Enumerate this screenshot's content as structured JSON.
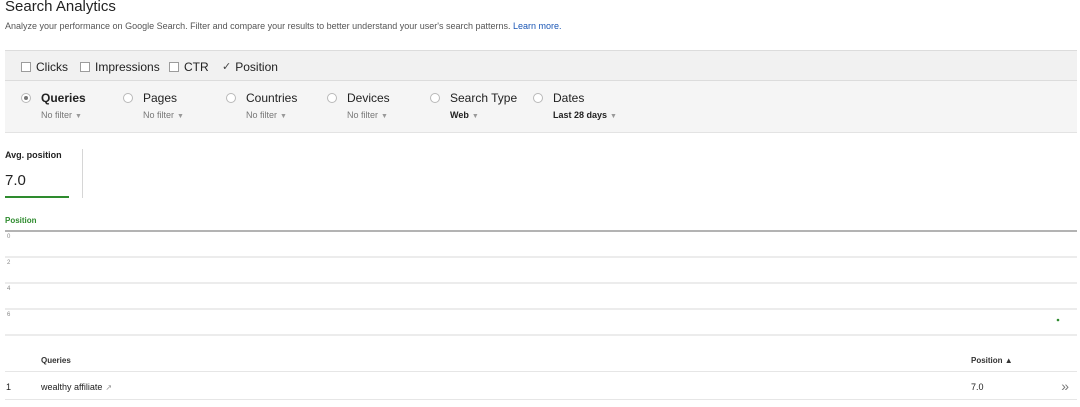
{
  "header": {
    "title": "Search Analytics",
    "subtitle": "Analyze your performance on Google Search. Filter and compare your results to better understand your user's search patterns.",
    "learn_more": "Learn more."
  },
  "metrics": [
    {
      "label": "Clicks",
      "checked": false
    },
    {
      "label": "Impressions",
      "checked": false
    },
    {
      "label": "CTR",
      "checked": false
    },
    {
      "label": "Position",
      "checked": true
    }
  ],
  "dimensions": [
    {
      "label": "Queries",
      "filter": "No filter",
      "selected": true
    },
    {
      "label": "Pages",
      "filter": "No filter",
      "selected": false
    },
    {
      "label": "Countries",
      "filter": "No filter",
      "selected": false
    },
    {
      "label": "Devices",
      "filter": "No filter",
      "selected": false
    },
    {
      "label": "Search Type",
      "filter": "Web",
      "selected": false
    },
    {
      "label": "Dates",
      "filter": "Last 28 days",
      "selected": false
    }
  ],
  "summary": {
    "label": "Avg. position",
    "value": "7.0"
  },
  "chart_data": {
    "type": "line",
    "title": "Position",
    "ylabel": "",
    "y_ticks": [
      "0",
      "2",
      "4",
      "6"
    ],
    "ylim": [
      0,
      8
    ],
    "y_inverted": true,
    "grid": true,
    "series": [
      {
        "name": "Position",
        "x": [
          28
        ],
        "values": [
          7.0
        ],
        "color": "#2e8b2e"
      }
    ],
    "xlim": [
      1,
      28
    ]
  },
  "table": {
    "headers": {
      "queries": "Queries",
      "position": "Position ▲"
    },
    "rows": [
      {
        "index": "1",
        "query": "wealthy affiliate",
        "position": "7.0"
      }
    ]
  },
  "icons": {
    "external_link": "↗",
    "expand": "»",
    "check": "✓",
    "caret": "▼"
  },
  "colors": {
    "accent": "#2e8b2e",
    "link": "#1a56b5"
  }
}
